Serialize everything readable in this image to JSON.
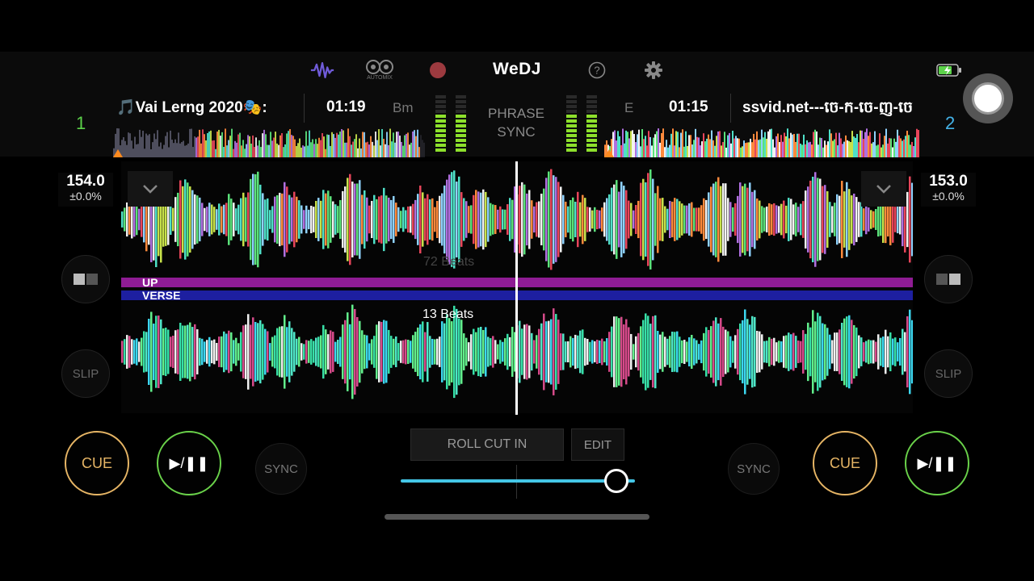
{
  "app": {
    "brand": "WeDJ",
    "automix_label": "AUTOMIX"
  },
  "deck1": {
    "number": "1",
    "title": "🎵Vai Lerng 2020🎭:",
    "time": "01:19",
    "key": "Bm",
    "bpm": "154.0",
    "pitch": "±0.0%",
    "slip_label": "SLIP",
    "cue_label": "CUE",
    "play_label": "▶/❚❚",
    "sync_label": "SYNC",
    "beats_label": "13 Beats",
    "beats_label_dim": "72 Beats"
  },
  "deck2": {
    "number": "2",
    "title": "ssvid.net---ចេ-ក-ចេ-ញ-ចេ",
    "time": "01:15",
    "key": "E",
    "bpm": "153.0",
    "pitch": "±0.0%",
    "slip_label": "SLIP",
    "cue_label": "CUE",
    "play_label": "▶/❚❚",
    "sync_label": "SYNC"
  },
  "center": {
    "phrase_sync_line1": "PHRASE",
    "phrase_sync_line2": "SYNC",
    "roll_cut_label": "ROLL CUT IN",
    "edit_label": "EDIT",
    "crossfader": 0.92
  },
  "phrases": {
    "upper": "UP",
    "lower": "VERSE"
  },
  "colors": {
    "accent_cue": "#e6b565",
    "accent_play": "#6ad24a",
    "deck1_number": "#5cd24a",
    "deck2_number": "#44b3e8",
    "crossfader": "#44c6e6",
    "phrase_up": "#8f1c94",
    "phrase_verse": "#1d1fa0"
  },
  "icons": [
    "waveform-icon",
    "automix-icon",
    "record-icon",
    "help-icon",
    "settings-icon",
    "battery-charging-icon",
    "layout-toggle-icon",
    "chevron-down-icon"
  ]
}
